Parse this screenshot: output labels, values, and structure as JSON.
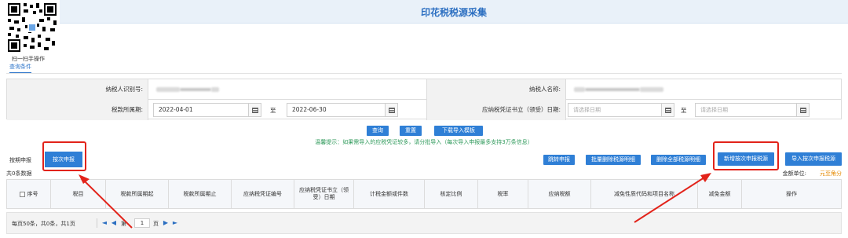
{
  "header": {
    "title": "印花税税源采集"
  },
  "qr": {
    "caption": "扫一扫手操作"
  },
  "query_tab": "查询条件",
  "form": {
    "taxpayer_id_label": "纳税人识别号:",
    "taxpayer_name_label": "纳税人名称:",
    "period_label": "税款所属期:",
    "period_start": "2022-04-01",
    "period_end": "2022-06-30",
    "to": "至",
    "voucher_date_label": "应纳税凭证书立（领受）日期:",
    "date_placeholder": "请选择日期"
  },
  "actions": {
    "query": "查询",
    "reset": "重置",
    "download_template": "下载导入模板"
  },
  "tip": "温馨提示：如果需导入的应税凭证较多，请分批导入（每次导入申报最多支持3万条信息）",
  "tabs": {
    "periodic": "按期申报",
    "per_transaction": "按次申报"
  },
  "toolbar": {
    "jump": "跳转申报",
    "batch_delete": "批量删除税源明细",
    "delete_all": "删除全部税源明细",
    "add_per_transaction": "新增按次申报税源",
    "import_per_transaction": "导入按次申报税源"
  },
  "count_text": "共0条数据",
  "unit": {
    "label": "金额单位:",
    "value": "元至角分"
  },
  "table": {
    "columns": [
      "序号",
      "税目",
      "税款所属期起",
      "税款所属期止",
      "应纳税凭证编号",
      "应纳税凭证书立（领受）日期",
      "计税金额或件数",
      "核定比例",
      "税率",
      "应纳税额",
      "减免性质代码和项目名称",
      "减免金额",
      "操作"
    ]
  },
  "pager": {
    "info": "每页50条，共0条，共1页",
    "page_prefix": "第",
    "page_value": "1",
    "page_suffix": "页"
  },
  "colors": {
    "primary": "#2f7fd6",
    "title": "#2c6fc1",
    "tip": "#2f9a5b",
    "highlight": "#e2231a",
    "unit": "#e58a00"
  }
}
